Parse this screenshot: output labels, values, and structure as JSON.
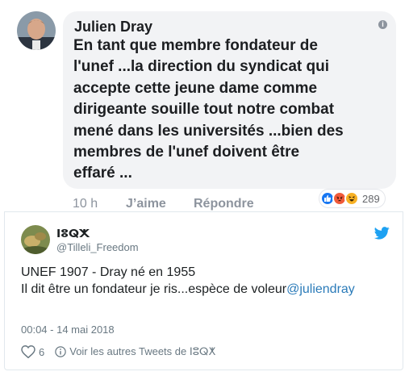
{
  "facebook_comment": {
    "author": "Julien Dray",
    "text_lines": [
      "En tant que membre fondateur de",
      "l'unef ...la direction du syndicat qui",
      "accepte cette jeune dame comme",
      "dirigeante souille tout notre combat",
      "mené dans les universités ...bien des",
      "membres de l'unef doivent être",
      "effaré ..."
    ],
    "time": "10 h",
    "like_label": "J’aime",
    "reply_label": "Répondre",
    "reaction_count": "289",
    "info_icon_glyph": "i"
  },
  "tweet": {
    "display_name": "ⵏⵓⵕⵅ",
    "handle": "@Tilleli_Freedom",
    "line1": "UNEF 1907 - Dray né en 1955",
    "line2_text": "Il dit être un fondateur je ris...espèce de voleur",
    "line2_mention": "@juliendray",
    "date": "00:04 - 14 mai 2018",
    "like_count": "6",
    "more_tweets_prefix": "Voir les autres Tweets de ",
    "more_tweets_name": "ⵏⵓⵕⵅ"
  },
  "colors": {
    "facebook_bubble": "#f2f3f5",
    "facebook_meta": "#8d949e",
    "twitter_blue": "#1da1f2",
    "mention": "#2b7bb9",
    "reaction_like": "#1877f2",
    "reaction_angry": "#f05a3a",
    "reaction_haha": "#f7b125"
  },
  "icons": [
    "info-icon",
    "like-reaction-icon",
    "angry-reaction-icon",
    "haha-reaction-icon",
    "twitter-bird-icon",
    "heart-icon",
    "info-circle-icon"
  ]
}
